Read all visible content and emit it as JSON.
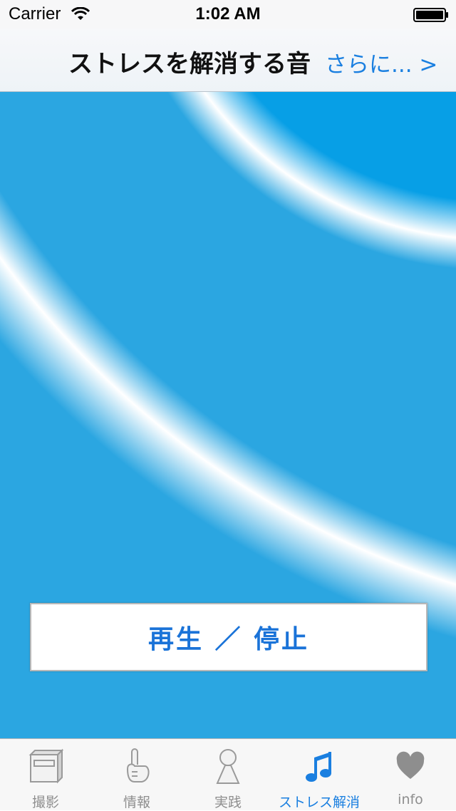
{
  "status_bar": {
    "carrier": "Carrier",
    "time": "1:02 AM",
    "wifi_icon": "wifi-icon",
    "battery_icon": "battery-icon"
  },
  "nav": {
    "title": "ストレスを解消する音",
    "more_link": "さらに... >"
  },
  "main": {
    "play_stop_label": "再生 ／ 停止",
    "background_color": "#2ba6e1"
  },
  "tab_bar": {
    "active_index": 3,
    "active_color": "#1a7fe0",
    "inactive_color": "#8e8e8e",
    "tabs": [
      {
        "label": "撮影",
        "icon": "camera-box-icon"
      },
      {
        "label": "情報",
        "icon": "hand-icon"
      },
      {
        "label": "実践",
        "icon": "person-icon"
      },
      {
        "label": "ストレス解消",
        "icon": "music-note-icon"
      },
      {
        "label": "info",
        "icon": "heart-icon"
      }
    ]
  }
}
